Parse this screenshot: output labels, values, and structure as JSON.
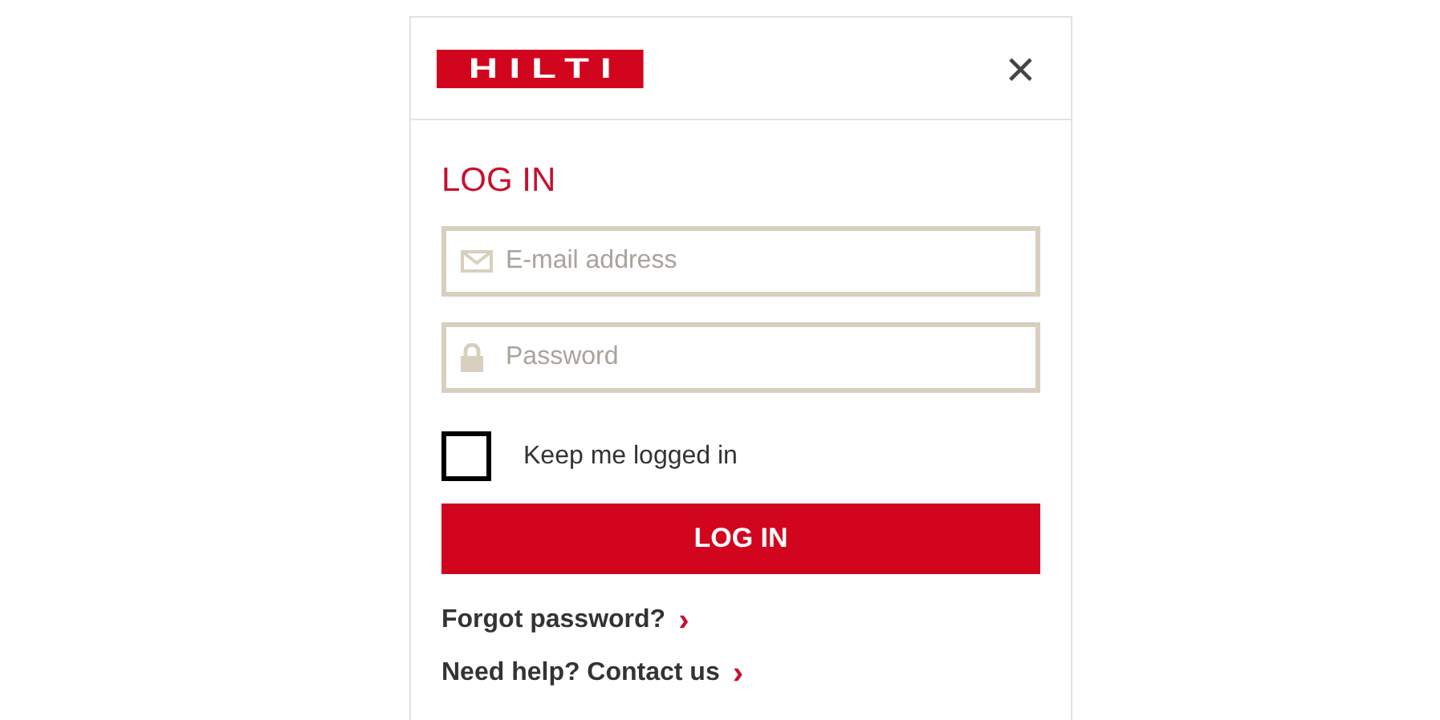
{
  "header": {
    "logo": "HILTI",
    "close": "×"
  },
  "title": "LOG IN",
  "fields": [
    {
      "kind": "email",
      "placeholder": "E-mail address"
    },
    {
      "kind": "password",
      "placeholder": "Password"
    }
  ],
  "remember": {
    "label": "Keep me logged in",
    "checked": false
  },
  "submit": "LOG IN",
  "links": [
    {
      "label": "Forgot password?",
      "arrow": "›"
    },
    {
      "label": "Need help? Contact us",
      "arrow": "›"
    }
  ]
}
